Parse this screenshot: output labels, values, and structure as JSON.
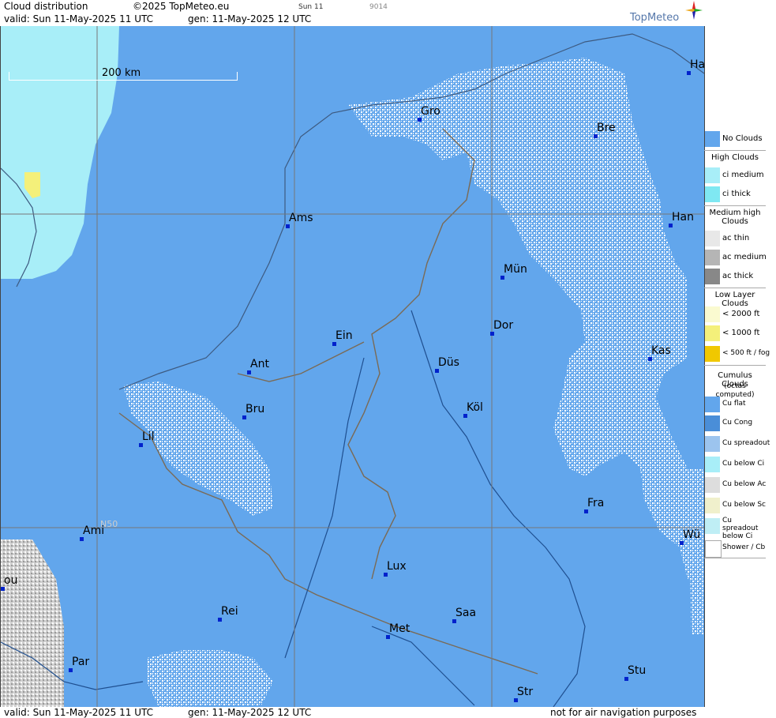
{
  "header": {
    "title": "Cloud distribution",
    "copyright": "©2025 TopMeteo.eu",
    "tiny_left": "Sun 11",
    "tiny_right": "9014",
    "valid": "valid:  Sun  11-May-2025  11 UTC",
    "gen": "gen: 11-May-2025 12 UTC"
  },
  "logo": "TopMeteo",
  "scale_bar": "200 km",
  "lat_label": "N50",
  "cities": [
    {
      "name": "Gro"
    },
    {
      "name": "Bre"
    },
    {
      "name": "Ha"
    },
    {
      "name": "Ams"
    },
    {
      "name": "Han"
    },
    {
      "name": "Mün"
    },
    {
      "name": "Ein"
    },
    {
      "name": "Dor"
    },
    {
      "name": "Ant"
    },
    {
      "name": "Düs"
    },
    {
      "name": "Kas"
    },
    {
      "name": "Bru"
    },
    {
      "name": "Köl"
    },
    {
      "name": "Lil"
    },
    {
      "name": "Fra"
    },
    {
      "name": "Ami"
    },
    {
      "name": "Wü"
    },
    {
      "name": "Lux"
    },
    {
      "name": "Rei"
    },
    {
      "name": "Saa"
    },
    {
      "name": "Met"
    },
    {
      "name": "Par"
    },
    {
      "name": "Stu"
    },
    {
      "name": "Str"
    },
    {
      "name": "ou"
    }
  ],
  "legend": {
    "no_clouds": "No Clouds",
    "high_title": "High Clouds",
    "ci_medium": "ci medium",
    "ci_thick": "ci thick",
    "medium_title": "Medium high Clouds",
    "ac_thin": "ac thin",
    "ac_medium": "ac medium",
    "ac_thick": "ac thick",
    "low_title": "Low Layer Clouds",
    "low_2000": "< 2000 ft",
    "low_1000": "< 1000 ft",
    "low_500": "< 500 ft / fog",
    "cu_title": "Cumulus Clouds",
    "cu_sub": "(octas computed)",
    "cu_flat": "Cu flat",
    "cu_cong": "Cu Cong",
    "cu_spreadout": "Cu spreadout",
    "cu_below_ci": "Cu below Ci",
    "cu_below_ac": "Cu below Ac",
    "cu_below_sc": "Cu below Sc",
    "cu_spread_below_ci": "Cu spreadout below Ci",
    "shower": "Shower / Cb"
  },
  "footer": {
    "valid": "valid:  Sun  11-May-2025  11 UTC",
    "gen": "gen: 11-May-2025 12 UTC",
    "note": "not for air navigation purposes"
  },
  "colors": {
    "no_clouds": "#62a6ec",
    "ci_medium": "#a8eef8",
    "ci_thick": "#7fe8f2",
    "cu_flat": "#ffffff",
    "low_yellow": "#f4f07a",
    "grey": "#bbbbbb"
  }
}
